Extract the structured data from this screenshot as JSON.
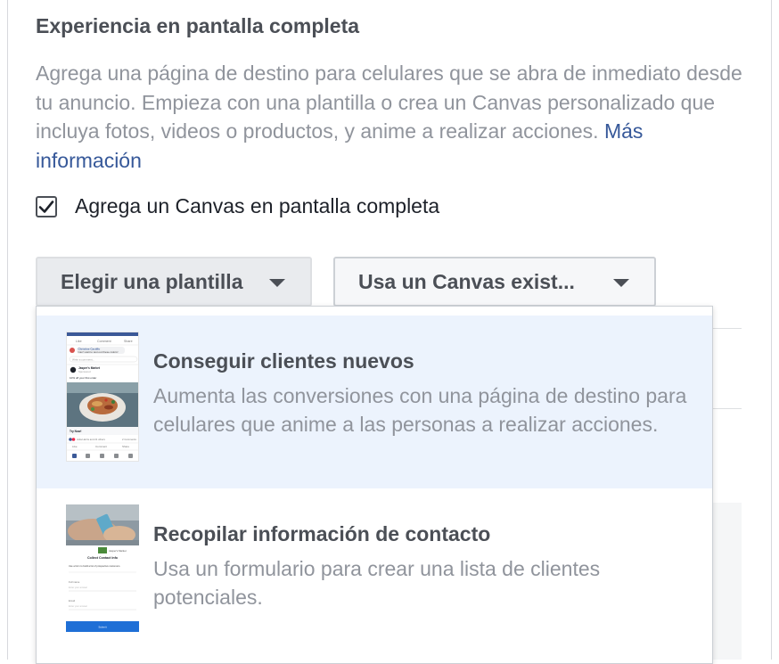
{
  "section": {
    "title": "Experiencia en pantalla completa",
    "description": "Agrega una página de destino para celulares que se abra de inmediato desde tu anuncio. Empieza con una plantilla o crea un Canvas personalizado que incluya fotos, videos o productos, y anime a realizar acciones.",
    "learn_more": "Más información"
  },
  "checkbox": {
    "label": "Agrega un Canvas en pantalla completa",
    "checked": true
  },
  "buttons": {
    "choose_template": "Elegir una plantilla",
    "use_existing": "Usa un Canvas exist..."
  },
  "dropdown": {
    "options": [
      {
        "title": "Conseguir clientes nuevos",
        "description": "Aumenta las conversiones con una página de destino para celulares que anime a las personas a realizar acciones.",
        "selected": true,
        "thumbnail": {
          "top_actions": [
            "Like",
            "Comment",
            "Share"
          ],
          "comment_author": "Christine Castillo",
          "comment_text": "Can't wait to test out these colors!",
          "write_comment": "Write a comment...",
          "page_name": "Jasper's Market",
          "page_meta": "Sponsored",
          "post_text": "10% off your first order",
          "cta": "Try Now!",
          "reactions": "Julia Harris and 21 others",
          "comments_count": "2 Comments"
        }
      },
      {
        "title": "Recopilar información de contacto",
        "description": "Usa un formulario para crear una lista de clientes potenciales.",
        "selected": false,
        "thumbnail": {
          "page_name": "Jasper's Market",
          "form_title": "Collect Contact Info",
          "form_text": "Use a form to build a list of prospective customers.",
          "field1_label": "Full name",
          "field1_placeholder": "Enter your answer",
          "field2_label": "Email",
          "field2_placeholder": "Enter your answer",
          "submit": "Submit"
        }
      }
    ]
  },
  "colors": {
    "link": "#365899",
    "selected_bg": "#ecf3fd",
    "button_blue": "#1f6fd6"
  }
}
